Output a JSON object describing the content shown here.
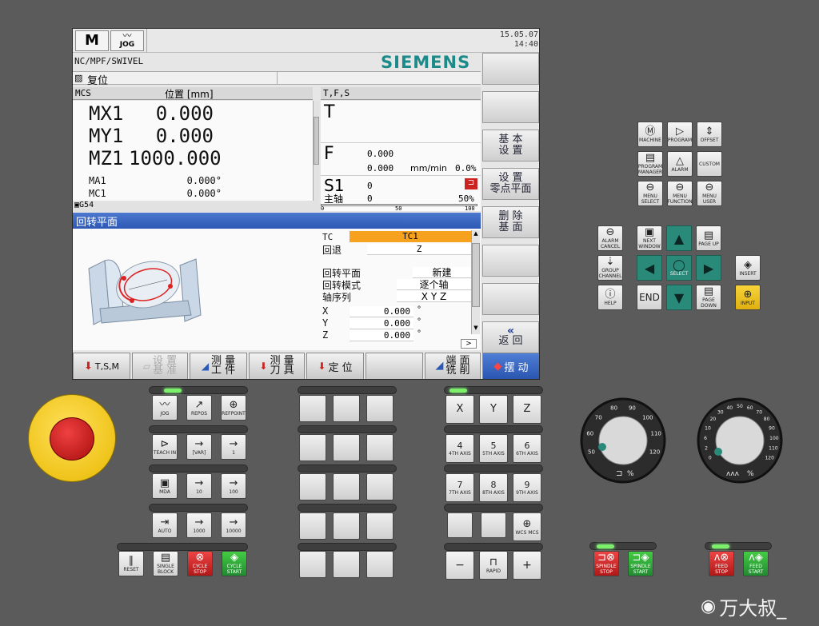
{
  "screen": {
    "mode_top": "JOG",
    "date": "15.05.07",
    "time": "14:40",
    "program_path": "NC/MPF/SWIVEL",
    "brand": "SIEMENS",
    "status": "复位",
    "pos_header_left": "MCS",
    "pos_header_mid": "位置 [mm]",
    "tfs_header": "T,F,S",
    "axes": [
      {
        "name": "MX1",
        "value": "0.000"
      },
      {
        "name": "MY1",
        "value": "0.000"
      },
      {
        "name": "MZ1",
        "value": "1000.000"
      }
    ],
    "aux_axes": [
      {
        "name": "MA1",
        "value": "0.000°"
      },
      {
        "name": "MC1",
        "value": "0.000°"
      }
    ],
    "frame": "G54",
    "t_label": "T",
    "f_label": "F",
    "f_value1": "0.000",
    "f_value2": "0.000",
    "f_unit": "mm/min",
    "f_percent": "0.0%",
    "s_label": "S1",
    "s_value": "0",
    "spindle_label": "主轴",
    "spindle_value": "0",
    "spindle_percent": "50%",
    "scale_0": "0",
    "scale_50": "50",
    "scale_100": "100",
    "dialog_title": "回转平面",
    "form": {
      "tc_label": "TC",
      "tc_value": "TC1",
      "retract_label": "回退",
      "retract_value": "Z",
      "plane_label": "回转平面",
      "plane_value": "新建",
      "mode_label": "回转模式",
      "mode_value": "逐个轴",
      "seq_label": "轴序列",
      "seq_value": "X Y Z",
      "x_label": "X",
      "x_value": "0.000",
      "y_label": "Y",
      "y_value": "0.000",
      "z_label": "Z",
      "z_value": "0.000",
      "deg": "°"
    },
    "vsoftkeys": [
      "",
      "",
      "基 本\n设 置",
      "设  置\n零点平面",
      "删 除\n基 面",
      "",
      "",
      "返 回"
    ],
    "hsoftkeys": [
      "T,S,M",
      "设 置\n基 准",
      "测 量\n工 件",
      "测 量\n刀 具",
      "定 位",
      "",
      "端 面\n铣 削",
      "摆 动"
    ]
  },
  "right_keys": {
    "row1": [
      "MACHINE",
      "PROGRAM",
      "OFFSET"
    ],
    "row2": [
      "PROGRAM MANAGER",
      "ALARM",
      "CUSTOM"
    ],
    "row3": [
      "MENU SELECT",
      "MENU FUNCTION",
      "MENU USER"
    ],
    "nav_left": [
      "ALARM CANCEL",
      "GROUP CHANNEL",
      "HELP"
    ],
    "nav": {
      "next_window": "NEXT WINDOW",
      "page_up": "PAGE UP",
      "select": "SELECT",
      "end": "END",
      "page_down": "PAGE DOWN"
    },
    "insert": "INSERT",
    "input": "INPUT"
  },
  "mode_keys": {
    "row1": [
      "JOG",
      "REPOS",
      "REFPOINT"
    ],
    "row2": [
      "TEACH IN",
      "[VAR]",
      "1"
    ],
    "row3": [
      "MDA",
      "10",
      "100"
    ],
    "row4": [
      "AUTO",
      "1000",
      "10000"
    ],
    "bottom": [
      "RESET",
      "SINGLE BLOCK",
      "CYCLE STOP",
      "CYCLE START"
    ]
  },
  "axis_keys": {
    "row1": [
      "X",
      "Y",
      "Z"
    ],
    "row2": [
      [
        "4",
        "4TH AXIS"
      ],
      [
        "5",
        "5TH AXIS"
      ],
      [
        "6",
        "6TH AXIS"
      ]
    ],
    "row3": [
      [
        "7",
        "7TH AXIS"
      ],
      [
        "8",
        "8TH AXIS"
      ],
      [
        "9",
        "9TH AXIS"
      ]
    ],
    "row4_right": "WCS MCS",
    "bottom": [
      "−",
      "RAPID",
      "+"
    ]
  },
  "dials": {
    "left_ticks": [
      "50",
      "60",
      "70",
      "80",
      "90",
      "100",
      "110",
      "120"
    ],
    "left_label": "%",
    "right_ticks": [
      "0",
      "2",
      "6",
      "10",
      "20",
      "30",
      "40",
      "50",
      "60",
      "70",
      "80",
      "90",
      "100",
      "110",
      "120"
    ],
    "right_label": "%"
  },
  "spindle_keys": [
    "SPINDLE STOP",
    "SPINDLE START"
  ],
  "feed_keys": [
    "FEED STOP",
    "FEED START"
  ],
  "watermark": "万大叔_",
  "colors": {
    "accent": "#3366cc",
    "orange": "#f7a21e",
    "teal": "#2a8a7a",
    "red": "#cc2222",
    "green": "#2aa040",
    "yellow": "#f0c020"
  }
}
